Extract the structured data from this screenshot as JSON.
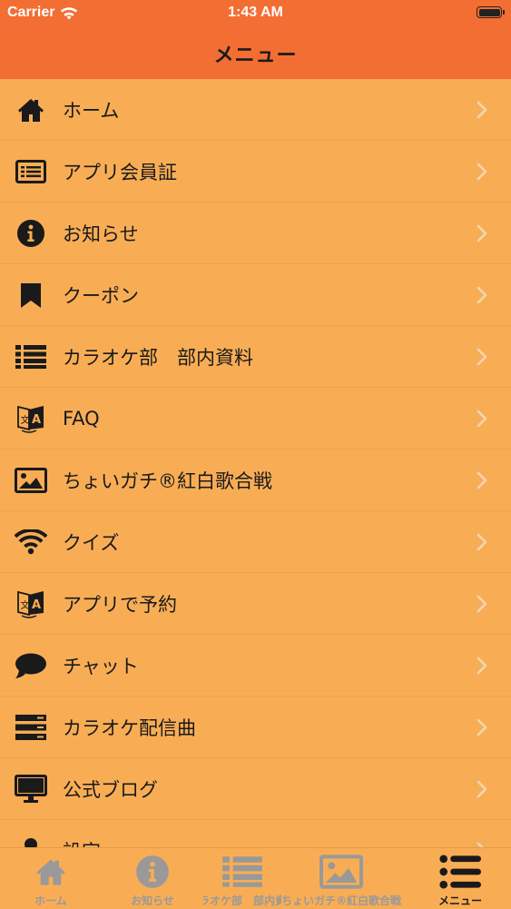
{
  "status_bar": {
    "carrier": "Carrier",
    "time": "1:43 AM"
  },
  "nav": {
    "title": "メニュー"
  },
  "menu": [
    {
      "label": "ホーム",
      "icon": "home-icon"
    },
    {
      "label": "アプリ会員証",
      "icon": "member-card-icon"
    },
    {
      "label": "お知らせ",
      "icon": "info-icon"
    },
    {
      "label": "クーポン",
      "icon": "bookmark-icon"
    },
    {
      "label": "カラオケ部　部内資料",
      "icon": "list-icon"
    },
    {
      "label": "FAQ",
      "icon": "translate-icon"
    },
    {
      "label": "ちょいガチ®紅白歌合戦",
      "icon": "image-icon"
    },
    {
      "label": "クイズ",
      "icon": "wifi-icon"
    },
    {
      "label": "アプリで予約",
      "icon": "translate-icon"
    },
    {
      "label": "チャット",
      "icon": "chat-bubble-icon"
    },
    {
      "label": "カラオケ配信曲",
      "icon": "server-icon"
    },
    {
      "label": "公式ブログ",
      "icon": "monitor-icon"
    },
    {
      "label": "設定",
      "icon": "person-icon"
    }
  ],
  "tabs": [
    {
      "label": "ホーム",
      "icon": "home-icon",
      "active": false
    },
    {
      "label": "お知らせ",
      "icon": "info-icon",
      "active": false
    },
    {
      "label": "カラオケ部　部内資料",
      "icon": "list-icon",
      "active": false
    },
    {
      "label": "ちょいガチ®紅白歌合戦",
      "icon": "image-icon",
      "active": false
    },
    {
      "label": "メニュー",
      "icon": "menu-icon",
      "active": true
    }
  ],
  "colors": {
    "header": "#F26E33",
    "background": "#F8AD55",
    "icon": "#1a1a1a",
    "tab_inactive": "#999999",
    "chevron": "#F3D7B4"
  }
}
